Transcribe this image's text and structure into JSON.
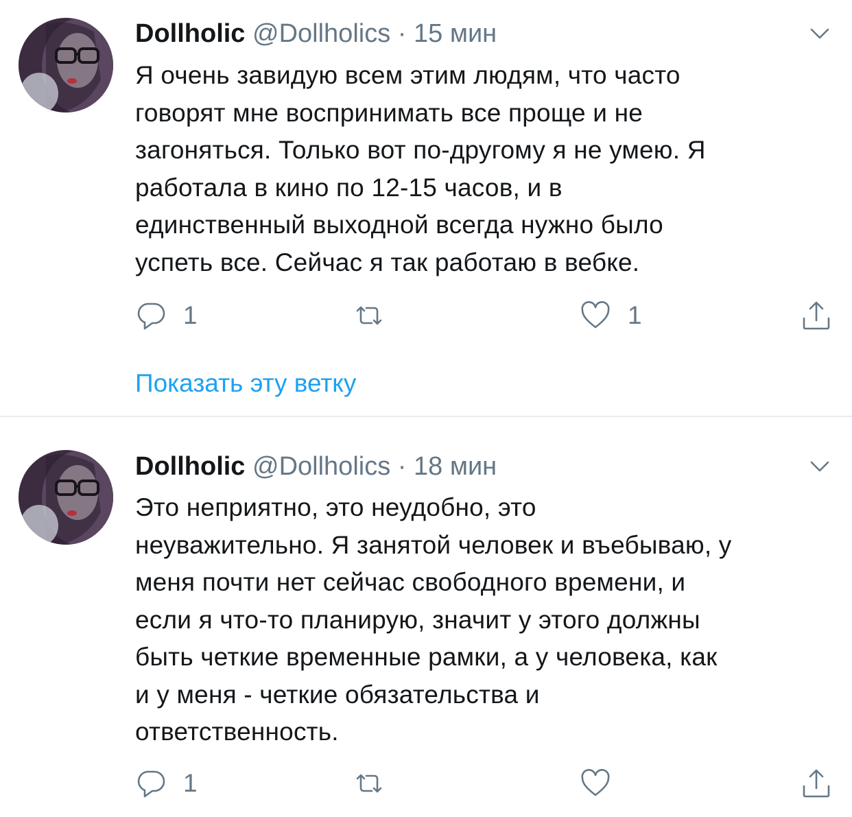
{
  "tweets": [
    {
      "display_name": "Dollholic",
      "handle": "@Dollholics",
      "separator": "·",
      "time": "15 мин",
      "text_lines": [
        "Я очень завидую всем этим людям, что часто",
        "говорят мне воспринимать все проще и не",
        "загоняться. Только вот по-другому я не умею. Я",
        "работала в кино по 12-15 часов, и в",
        "единственный выходной всегда нужно было",
        "успеть все. Сейчас я так работаю в вебке."
      ],
      "reply_count": "1",
      "retweet_count": "",
      "like_count": "1",
      "show_thread_label": "Показать эту ветку"
    },
    {
      "display_name": "Dollholic",
      "handle": "@Dollholics",
      "separator": "·",
      "time": "18 мин",
      "text_lines": [
        "Это неприятно, это неудобно, это",
        "неуважительно. Я занятой человек и въебываю, у",
        "меня почти нет сейчас свободного времени, и",
        "если я что-то планирую, значит у этого должны",
        "быть четкие временные рамки,  а у человека, как",
        "и у меня - четкие обязательства и",
        "ответственность."
      ],
      "reply_count": "1",
      "retweet_count": "",
      "like_count": ""
    }
  ],
  "icons": {
    "reply": "reply-icon",
    "retweet": "retweet-icon",
    "like": "heart-icon",
    "share": "share-icon",
    "menu": "chevron-down-icon"
  },
  "colors": {
    "text": "#14171a",
    "secondary": "#657786",
    "link": "#1da1f2",
    "divider": "#e6ecf0"
  }
}
